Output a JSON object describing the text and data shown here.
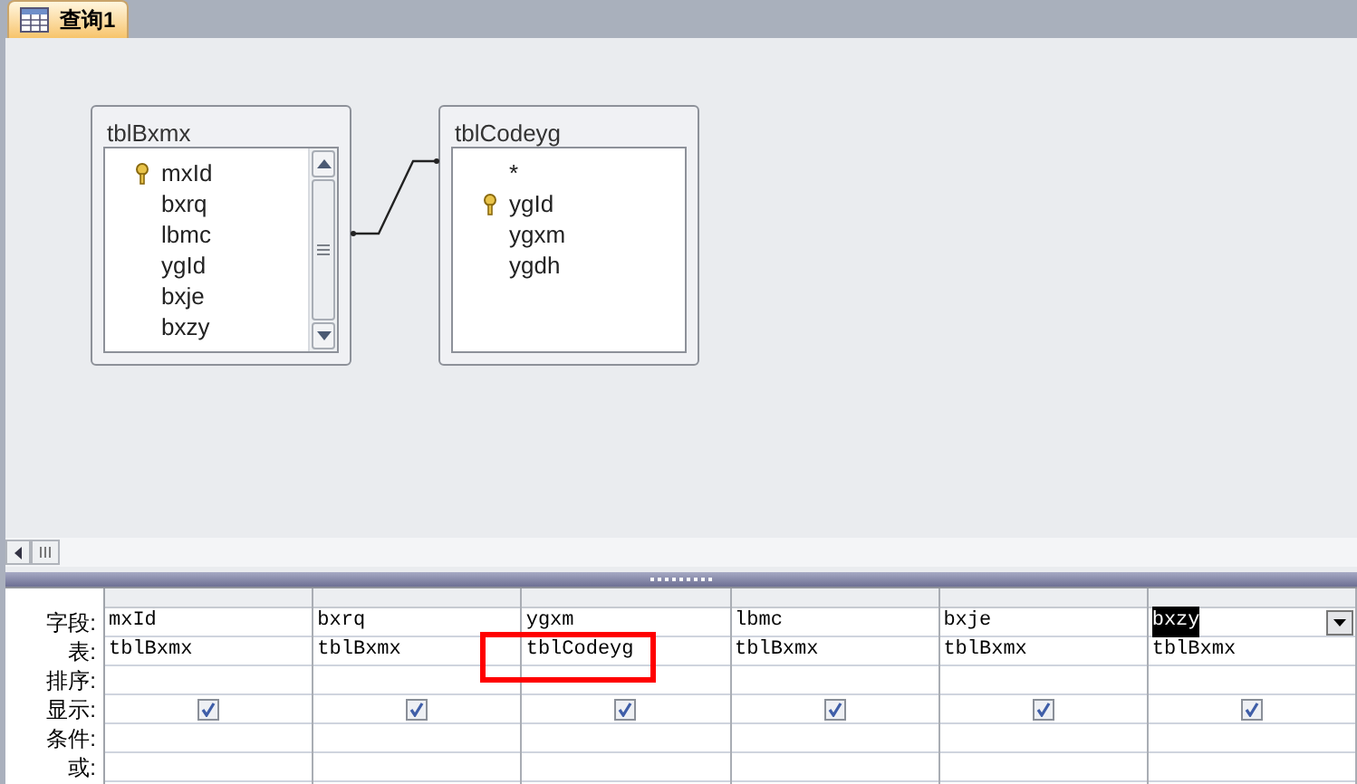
{
  "tab": {
    "title": "查询1"
  },
  "tables": [
    {
      "name": "tblBxmx",
      "scrollbar": true,
      "fields": [
        {
          "name": "mxId",
          "key": true
        },
        {
          "name": "bxrq",
          "key": false
        },
        {
          "name": "lbmc",
          "key": false
        },
        {
          "name": "ygId",
          "key": false
        },
        {
          "name": "bxje",
          "key": false
        },
        {
          "name": "bxzy",
          "key": false
        }
      ]
    },
    {
      "name": "tblCodeyg",
      "scrollbar": false,
      "fields": [
        {
          "name": "*",
          "key": false
        },
        {
          "name": "ygId",
          "key": true
        },
        {
          "name": "ygxm",
          "key": false
        },
        {
          "name": "ygdh",
          "key": false
        }
      ]
    }
  ],
  "grid": {
    "row_labels": [
      "字段:",
      "表:",
      "排序:",
      "显示:",
      "条件:",
      "或:"
    ],
    "columns": [
      {
        "field": "mxId",
        "table": "tblBxmx",
        "show": true,
        "selected": false,
        "highlighted": false
      },
      {
        "field": "bxrq",
        "table": "tblBxmx",
        "show": true,
        "selected": false,
        "highlighted": false
      },
      {
        "field": "ygxm",
        "table": "tblCodeyg",
        "show": true,
        "selected": false,
        "highlighted": true
      },
      {
        "field": "lbmc",
        "table": "tblBxmx",
        "show": true,
        "selected": false,
        "highlighted": false
      },
      {
        "field": "bxje",
        "table": "tblBxmx",
        "show": true,
        "selected": false,
        "highlighted": false
      },
      {
        "field": "bxzy",
        "table": "tblBxmx",
        "show": true,
        "selected": true,
        "highlighted": false
      }
    ]
  }
}
